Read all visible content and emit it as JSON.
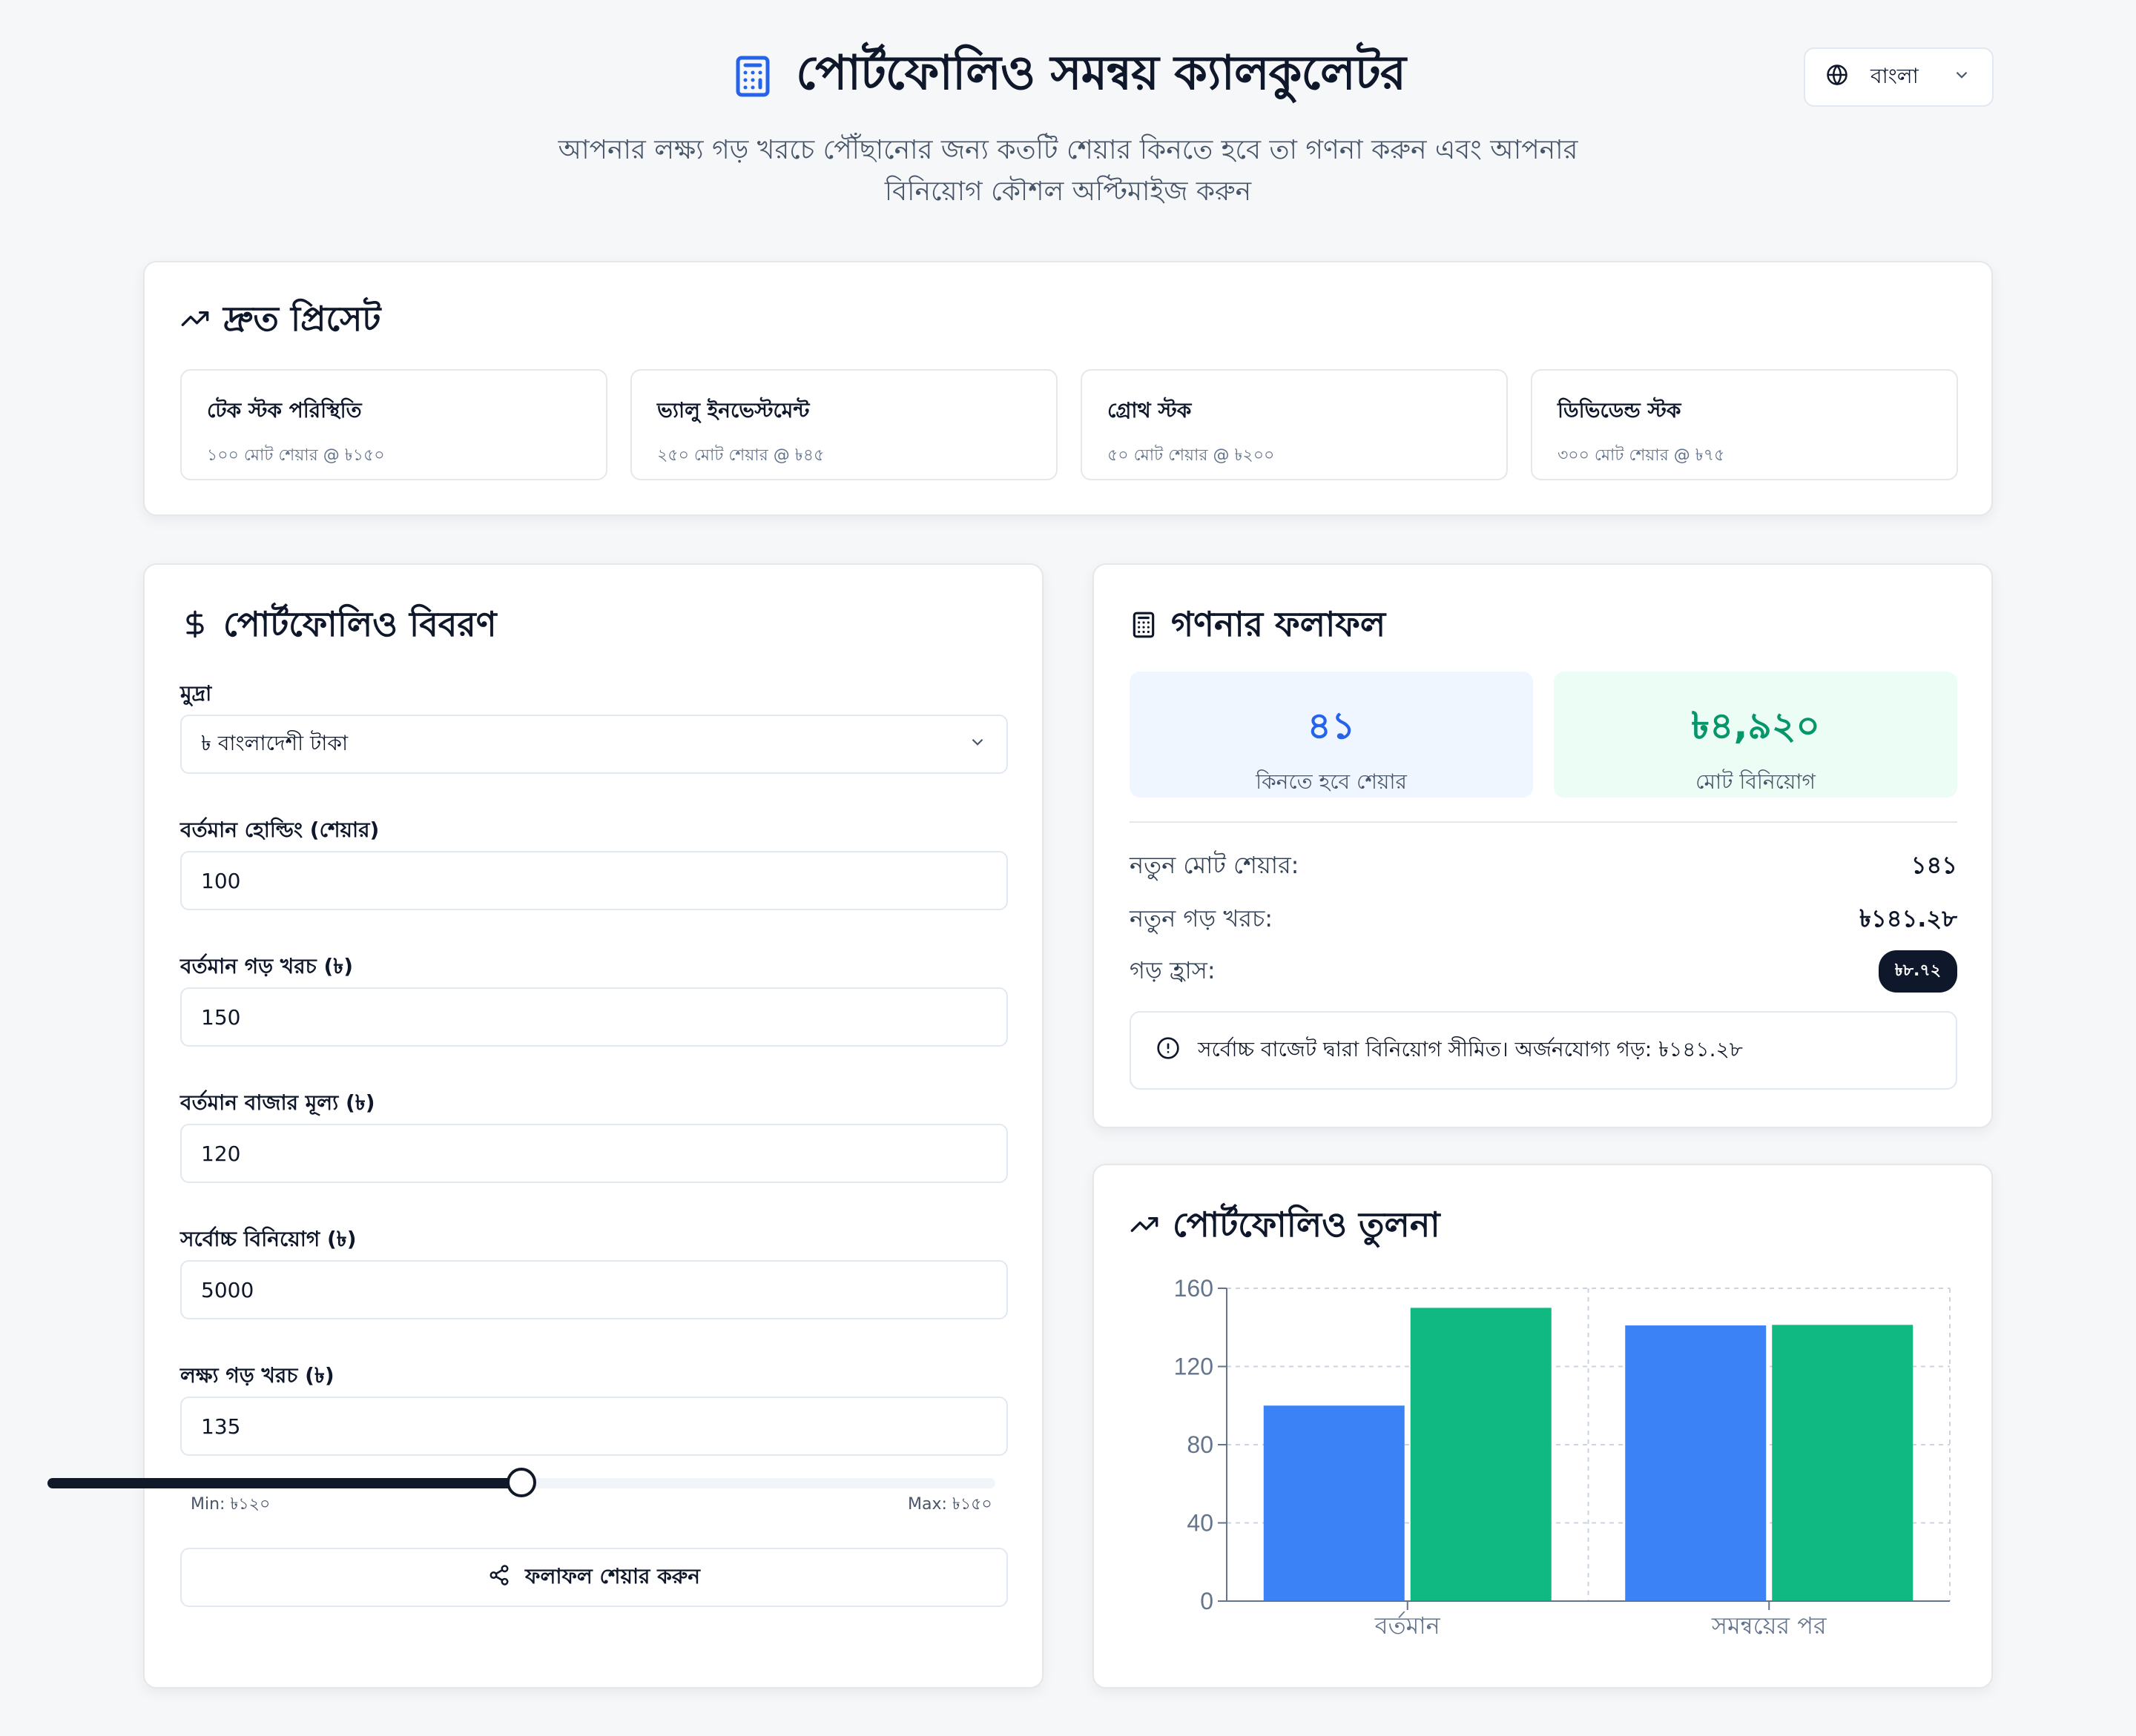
{
  "header": {
    "title": "পোর্টফোলিও সমন্বয় ক্যালকুলেটর",
    "subtitle": "আপনার লক্ষ্য গড় খরচে পৌঁছানোর জন্য কতটি শেয়ার কিনতে হবে তা গণনা করুন এবং আপনার বিনিয়োগ কৌশল অপ্টিমাইজ করুন",
    "language": "বাংলা"
  },
  "presets": {
    "title": "দ্রুত প্রিসেট",
    "items": [
      {
        "title": "টেক স্টক পরিস্থিতি",
        "desc": "১০০ মোট শেয়ার @ ৳১৫০"
      },
      {
        "title": "ভ্যালু ইনভেস্টমেন্ট",
        "desc": "২৫০ মোট শেয়ার @ ৳৪৫"
      },
      {
        "title": "গ্রোথ স্টক",
        "desc": "৫০ মোট শেয়ার @ ৳২০০"
      },
      {
        "title": "ডিভিডেন্ড স্টক",
        "desc": "৩০০ মোট শেয়ার @ ৳৭৫"
      }
    ]
  },
  "details": {
    "title": "পোর্টফোলিও বিবরণ",
    "currency_label": "মুদ্রা",
    "currency_value": "৳ বাংলাদেশী টাকা",
    "holding_label": "বর্তমান হোল্ডিং (শেয়ার)",
    "holding_value": "100",
    "avg_cost_label": "বর্তমান গড় খরচ (৳)",
    "avg_cost_value": "150",
    "market_price_label": "বর্তমান বাজার মূল্য (৳)",
    "market_price_value": "120",
    "max_invest_label": "সর্বোচ্চ বিনিয়োগ (৳)",
    "max_invest_value": "5000",
    "target_label": "লক্ষ্য গড় খরচ (৳)",
    "target_value": "135",
    "slider_min_label": "Min: ৳১২০",
    "slider_max_label": "Max: ৳১৫০",
    "slider_fraction": 0.5,
    "share_label": "ফলাফল শেয়ার করুন"
  },
  "results": {
    "title": "গণনার ফলাফল",
    "shares_to_buy": "৪১",
    "shares_to_buy_caption": "কিনতে হবে শেয়ার",
    "total_investment": "৳৪,৯২০",
    "total_investment_caption": "মোট বিনিয়োগ",
    "new_total_label": "নতুন মোট শেয়ার:",
    "new_total_value": "১৪১",
    "new_avg_label": "নতুন গড় খরচ:",
    "new_avg_value": "৳১৪১.২৮",
    "reduction_label": "গড় হ্রাস:",
    "reduction_value": "৳৮.৭২",
    "alert": "সর্বোচ্চ বাজেট দ্বারা বিনিয়োগ সীমিত। অর্জনযোগ্য গড়: ৳১৪১.২৮"
  },
  "colors": {
    "primary": "#3b82f6",
    "success": "#10b981",
    "blue_bg": "#eff6ff",
    "green_bg": "#ecfdf5",
    "blue_text": "#2563eb",
    "green_text": "#059669"
  },
  "comparison": {
    "title": "পোর্টফোলিও তুলনা"
  },
  "chart_data": {
    "type": "bar",
    "categories": [
      "বর্তমান",
      "সমন্বয়ের পর"
    ],
    "series": [
      {
        "values": [
          100,
          141
        ],
        "color": "#3b82f6"
      },
      {
        "values": [
          150,
          141.28
        ],
        "color": "#10b981"
      }
    ],
    "ylim": [
      0,
      160
    ],
    "yticks": [
      0,
      40,
      80,
      120,
      160
    ],
    "grid": true
  }
}
